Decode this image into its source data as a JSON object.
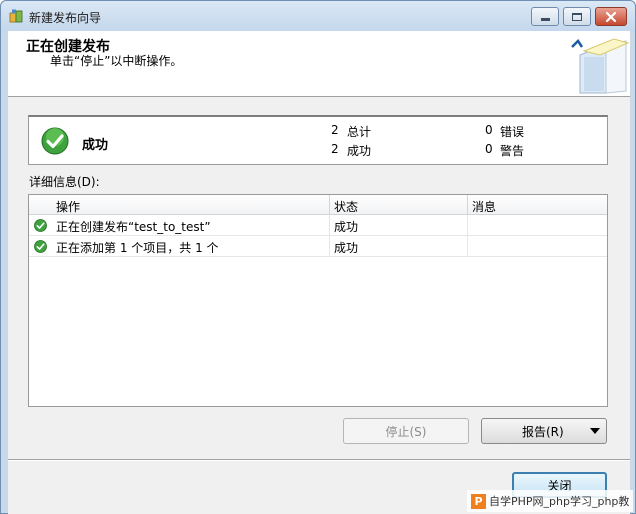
{
  "window": {
    "title": "新建发布向导"
  },
  "header": {
    "title": "正在创建发布",
    "subtitle": "单击“停止”以中断操作。"
  },
  "summary": {
    "status": "成功",
    "total_count": "2",
    "total_label": "总计",
    "success_count": "2",
    "success_label": "成功",
    "error_count": "0",
    "error_label": "错误",
    "warning_count": "0",
    "warning_label": "警告"
  },
  "details": {
    "label": "详细信息(D):",
    "columns": [
      "操作",
      "状态",
      "消息"
    ],
    "rows": [
      {
        "operation": "正在创建发布“test_to_test”",
        "status": "成功",
        "message": ""
      },
      {
        "operation": "正在添加第 1 个项目，共 1 个",
        "status": "成功",
        "message": ""
      }
    ]
  },
  "buttons": {
    "stop": "停止(S)",
    "report": "报告(R)",
    "close": "关闭"
  },
  "watermark": {
    "logo": "P",
    "text": "自学PHP网_php学习_php教"
  },
  "colors": {
    "success": "#2e9b2e",
    "accent": "#3c7fb1",
    "watermark": "#f07f1d"
  }
}
